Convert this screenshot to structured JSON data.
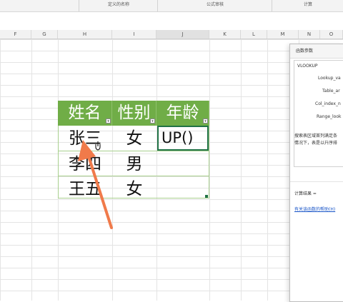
{
  "ribbon": {
    "groups": [
      "定义的名称",
      "公式审核",
      "计算"
    ]
  },
  "columns": [
    "F",
    "G",
    "H",
    "I",
    "J",
    "K",
    "L",
    "M",
    "N",
    "O"
  ],
  "table": {
    "headers": [
      "姓名",
      "性别",
      "年龄"
    ],
    "rows": [
      {
        "name": "张三",
        "gender": "女",
        "age": "UP()"
      },
      {
        "name": "李四",
        "gender": "男",
        "age": ""
      },
      {
        "name": "王五",
        "gender": "女",
        "age": ""
      }
    ],
    "dropdown_glyph": "▾"
  },
  "dialog": {
    "title": "函数参数",
    "function_name": "VLOOKUP",
    "params": [
      "Lookup_va",
      "Table_ar",
      "Col_index_n",
      "Range_look"
    ],
    "description_line1": "搜索表区域首列满足条",
    "description_line2": "情况下，表是以升序排",
    "result_label": "计算结果 =",
    "help_link": "有关该函数的帮助(H)"
  },
  "colors": {
    "header_green": "#70ad47",
    "arrow_orange": "#f07a4a",
    "selection_green": "#217346"
  }
}
